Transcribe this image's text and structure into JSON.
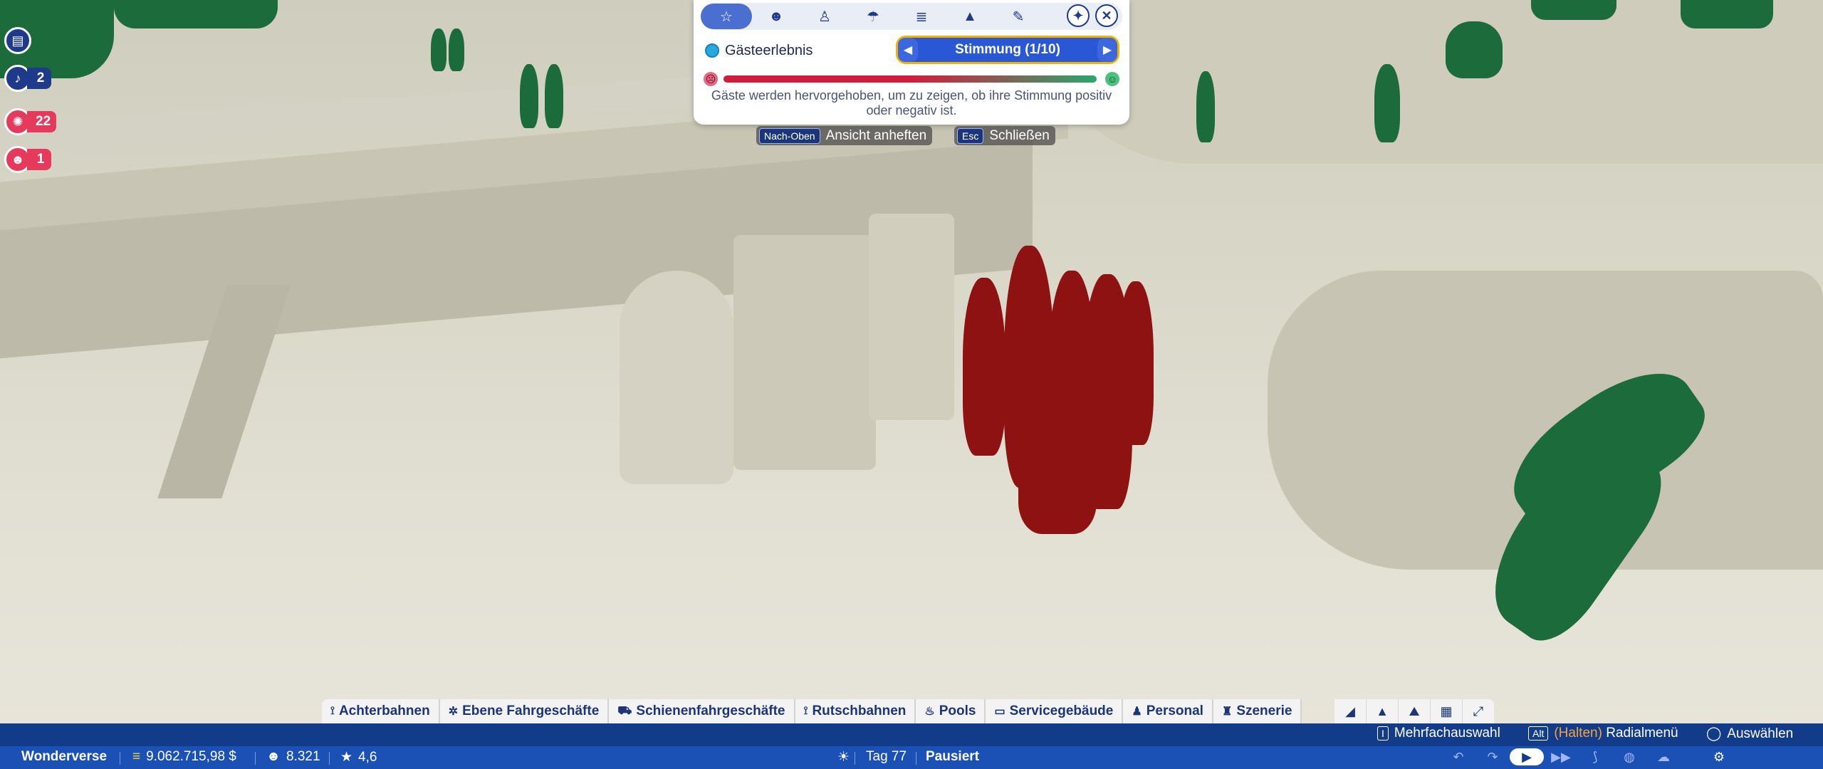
{
  "view_panel": {
    "layer_name": "Gästeerlebnis",
    "selector_label": "Stimmung (1/10)",
    "description": "Gäste werden hervorgehoben, um zu zeigen, ob ihre Stimmung positiv oder negativ ist.",
    "tab_icons": [
      "guest-star-icon",
      "guest-group-icon",
      "person-icon",
      "weather-icon",
      "money-stack-icon",
      "tree-icon",
      "wrench-icon"
    ],
    "active_tab": 0
  },
  "hints": {
    "pin_key": "Nach-Oben",
    "pin_label": "Ansicht anheften",
    "close_key": "Esc",
    "close_label": "Schließen"
  },
  "notifications": {
    "bell_count": "2",
    "ride_count": "22",
    "guest_count": "1"
  },
  "categories": [
    {
      "icon": "⟟",
      "label": "Achterbahnen"
    },
    {
      "icon": "✲",
      "label": "Ebene Fahrgeschäfte"
    },
    {
      "icon": "⛟",
      "label": "Schienenfahrgeschäfte"
    },
    {
      "icon": "⟟",
      "label": "Rutschbahnen"
    },
    {
      "icon": "♨",
      "label": "Pools"
    },
    {
      "icon": "▭",
      "label": "Servicegebäude"
    },
    {
      "icon": "♟",
      "label": "Personal"
    },
    {
      "icon": "♜",
      "label": "Szenerie"
    }
  ],
  "status_bar": {
    "park_name": "Wonderverse",
    "money": "9.062.715,98 $",
    "guests": "8.321",
    "rating": "4,6",
    "day": "Tag 77",
    "state": "Pausiert",
    "multi_select_label": "Mehrfachauswahl",
    "radial_key": "Alt",
    "radial_hold": "(Halten)",
    "radial_label": "Radialmenü",
    "select_label": "Auswählen"
  },
  "colors": {
    "accent": "#2a57d6",
    "selector_border": "#f0b400",
    "negative_guest": "#8e1212",
    "positive_guest": "#1c6b3a",
    "status_bar": "#123b8a"
  }
}
